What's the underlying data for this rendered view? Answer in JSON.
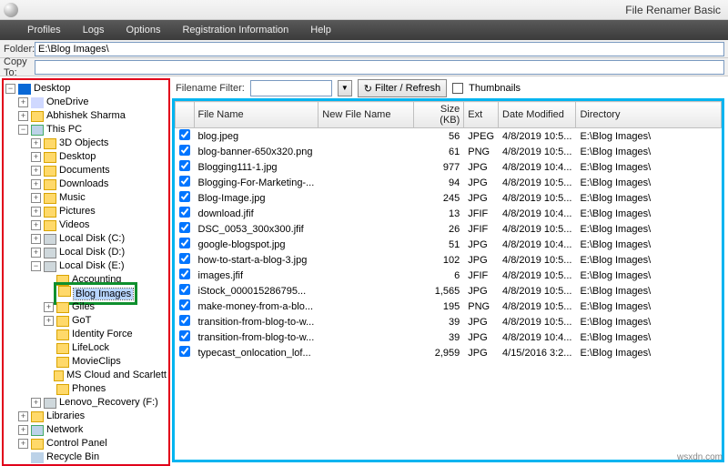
{
  "app": {
    "title": "File Renamer Basic"
  },
  "menu": {
    "profiles": "Profiles",
    "logs": "Logs",
    "options": "Options",
    "reg": "Registration Information",
    "help": "Help"
  },
  "folderRow": {
    "label": "Folder:",
    "value": "E:\\Blog Images\\"
  },
  "copyRow": {
    "label": "Copy To:",
    "value": ""
  },
  "filter": {
    "label": "Filename Filter:",
    "value": "",
    "btn": "Filter / Refresh",
    "thumbs": "Thumbnails"
  },
  "tree": {
    "desktop": "Desktop",
    "onedrive": "OneDrive",
    "user": "Abhishek Sharma",
    "thispc": "This PC",
    "threed": "3D Objects",
    "desktopf": "Desktop",
    "documents": "Documents",
    "downloads": "Downloads",
    "music": "Music",
    "pictures": "Pictures",
    "videos": "Videos",
    "cdrive": "Local Disk (C:)",
    "ddrive": "Local Disk (D:)",
    "edrive": "Local Disk (E:)",
    "accounting": "Accounting",
    "blogimages": "Blog Images",
    "giles": "Giles",
    "got": "GoT",
    "identity": "Identity Force",
    "lifelock": "LifeLock",
    "movieclips": "MovieClips",
    "mscloud": "MS Cloud and Scarlett",
    "phones": "Phones",
    "lenovo": "Lenovo_Recovery (F:)",
    "libraries": "Libraries",
    "network": "Network",
    "cpanel": "Control Panel",
    "recycle": "Recycle Bin"
  },
  "cols": {
    "chk": "",
    "fn": "File Name",
    "nfn": "New File Name",
    "size": "Size (KB)",
    "ext": "Ext",
    "dm": "Date Modified",
    "dir": "Directory"
  },
  "rows": [
    {
      "fn": "blog.jpeg",
      "size": "56",
      "ext": "JPEG",
      "dm": "4/8/2019 10:5...",
      "dir": "E:\\Blog Images\\"
    },
    {
      "fn": "blog-banner-650x320.png",
      "size": "61",
      "ext": "PNG",
      "dm": "4/8/2019 10:5...",
      "dir": "E:\\Blog Images\\"
    },
    {
      "fn": "Blogging111-1.jpg",
      "size": "977",
      "ext": "JPG",
      "dm": "4/8/2019 10:4...",
      "dir": "E:\\Blog Images\\"
    },
    {
      "fn": "Blogging-For-Marketing-...",
      "size": "94",
      "ext": "JPG",
      "dm": "4/8/2019 10:5...",
      "dir": "E:\\Blog Images\\"
    },
    {
      "fn": "Blog-Image.jpg",
      "size": "245",
      "ext": "JPG",
      "dm": "4/8/2019 10:5...",
      "dir": "E:\\Blog Images\\"
    },
    {
      "fn": "download.jfif",
      "size": "13",
      "ext": "JFIF",
      "dm": "4/8/2019 10:4...",
      "dir": "E:\\Blog Images\\"
    },
    {
      "fn": "DSC_0053_300x300.jfif",
      "size": "26",
      "ext": "JFIF",
      "dm": "4/8/2019 10:5...",
      "dir": "E:\\Blog Images\\"
    },
    {
      "fn": "google-blogspot.jpg",
      "size": "51",
      "ext": "JPG",
      "dm": "4/8/2019 10:4...",
      "dir": "E:\\Blog Images\\"
    },
    {
      "fn": "how-to-start-a-blog-3.jpg",
      "size": "102",
      "ext": "JPG",
      "dm": "4/8/2019 10:5...",
      "dir": "E:\\Blog Images\\"
    },
    {
      "fn": "images.jfif",
      "size": "6",
      "ext": "JFIF",
      "dm": "4/8/2019 10:5...",
      "dir": "E:\\Blog Images\\"
    },
    {
      "fn": "iStock_000015286795...",
      "size": "1,565",
      "ext": "JPG",
      "dm": "4/8/2019 10:5...",
      "dir": "E:\\Blog Images\\"
    },
    {
      "fn": "make-money-from-a-blo...",
      "size": "195",
      "ext": "PNG",
      "dm": "4/8/2019 10:5...",
      "dir": "E:\\Blog Images\\"
    },
    {
      "fn": "transition-from-blog-to-w...",
      "size": "39",
      "ext": "JPG",
      "dm": "4/8/2019 10:5...",
      "dir": "E:\\Blog Images\\"
    },
    {
      "fn": "transition-from-blog-to-w...",
      "size": "39",
      "ext": "JPG",
      "dm": "4/8/2019 10:4...",
      "dir": "E:\\Blog Images\\"
    },
    {
      "fn": "typecast_onlocation_lof...",
      "size": "2,959",
      "ext": "JPG",
      "dm": "4/15/2016 3:2...",
      "dir": "E:\\Blog Images\\"
    }
  ],
  "watermark": "wsxdn.com"
}
